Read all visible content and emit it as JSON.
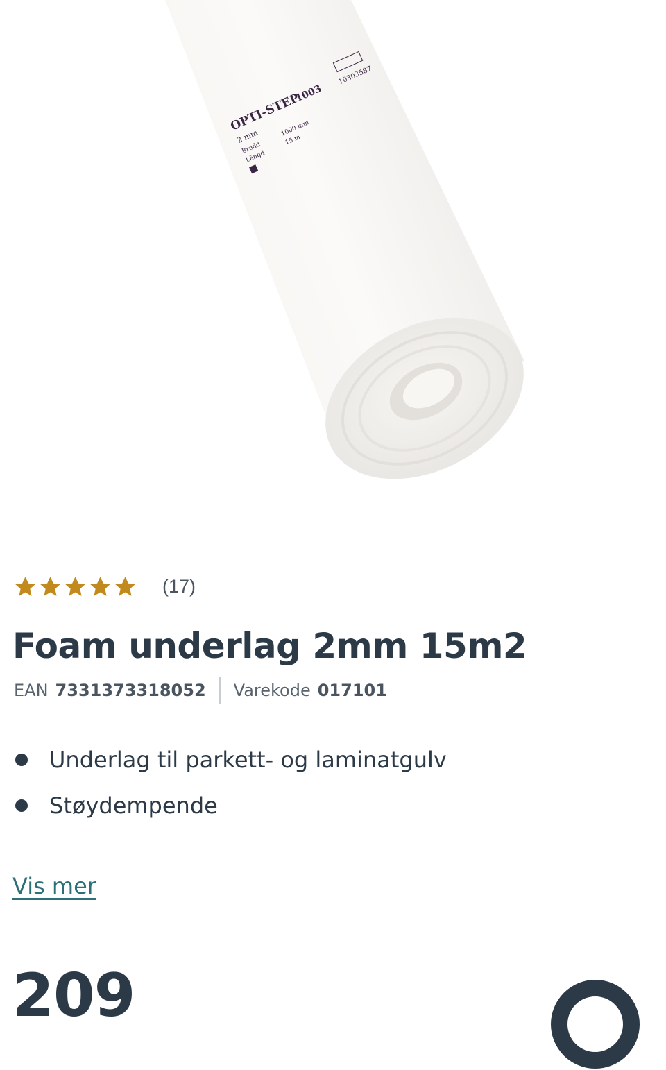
{
  "product": {
    "title": "Foam underlag 2mm 15m2",
    "rating": {
      "value": 5,
      "max": 5,
      "count_label": "(17)",
      "star_color": "#c28a1d"
    },
    "ean_label": "EAN",
    "ean_value": "7331373318052",
    "code_label": "Varekode",
    "code_value": "017101",
    "bullets": [
      "Underlag til parkett- og laminatgulv",
      "Støydempende"
    ],
    "show_more": "Vis mer",
    "price": "209",
    "image_label": {
      "brand": "OPTI-STEP",
      "model": "1003",
      "thickness": "2 mm",
      "width_label": "Bredd",
      "width": "1000 mm",
      "length_label": "Längd",
      "length": "15 m",
      "batch": "10303587"
    }
  },
  "colors": {
    "text": "#2c3a47",
    "link": "#2d6f77",
    "star": "#c28a1d",
    "divider": "#c8cdd2"
  }
}
